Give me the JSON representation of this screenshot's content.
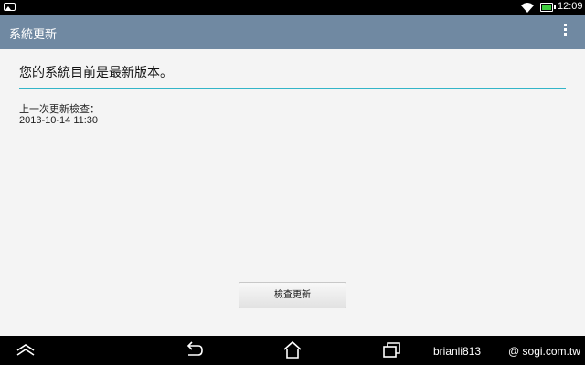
{
  "status_bar": {
    "time": "12:09",
    "icons": [
      "notification-image-icon",
      "wifi-icon",
      "battery-icon"
    ],
    "battery_color": "#3fcf3f"
  },
  "action_bar": {
    "title": "系統更新",
    "overflow_icon": "overflow-menu-icon",
    "background": "#7089a2"
  },
  "content": {
    "headline": "您的系統目前是最新版本。",
    "last_check_label": "上一次更新檢查：",
    "last_check_time": "2013-10-14 11:30",
    "check_button_label": "檢查更新",
    "accent": "#33b5c8"
  },
  "nav_bar": {
    "buttons": [
      "hide-nav-icon",
      "back-icon",
      "home-icon",
      "recent-apps-icon"
    ]
  },
  "watermark": {
    "left": "brianli813",
    "right": "@ sogi.com.tw"
  }
}
